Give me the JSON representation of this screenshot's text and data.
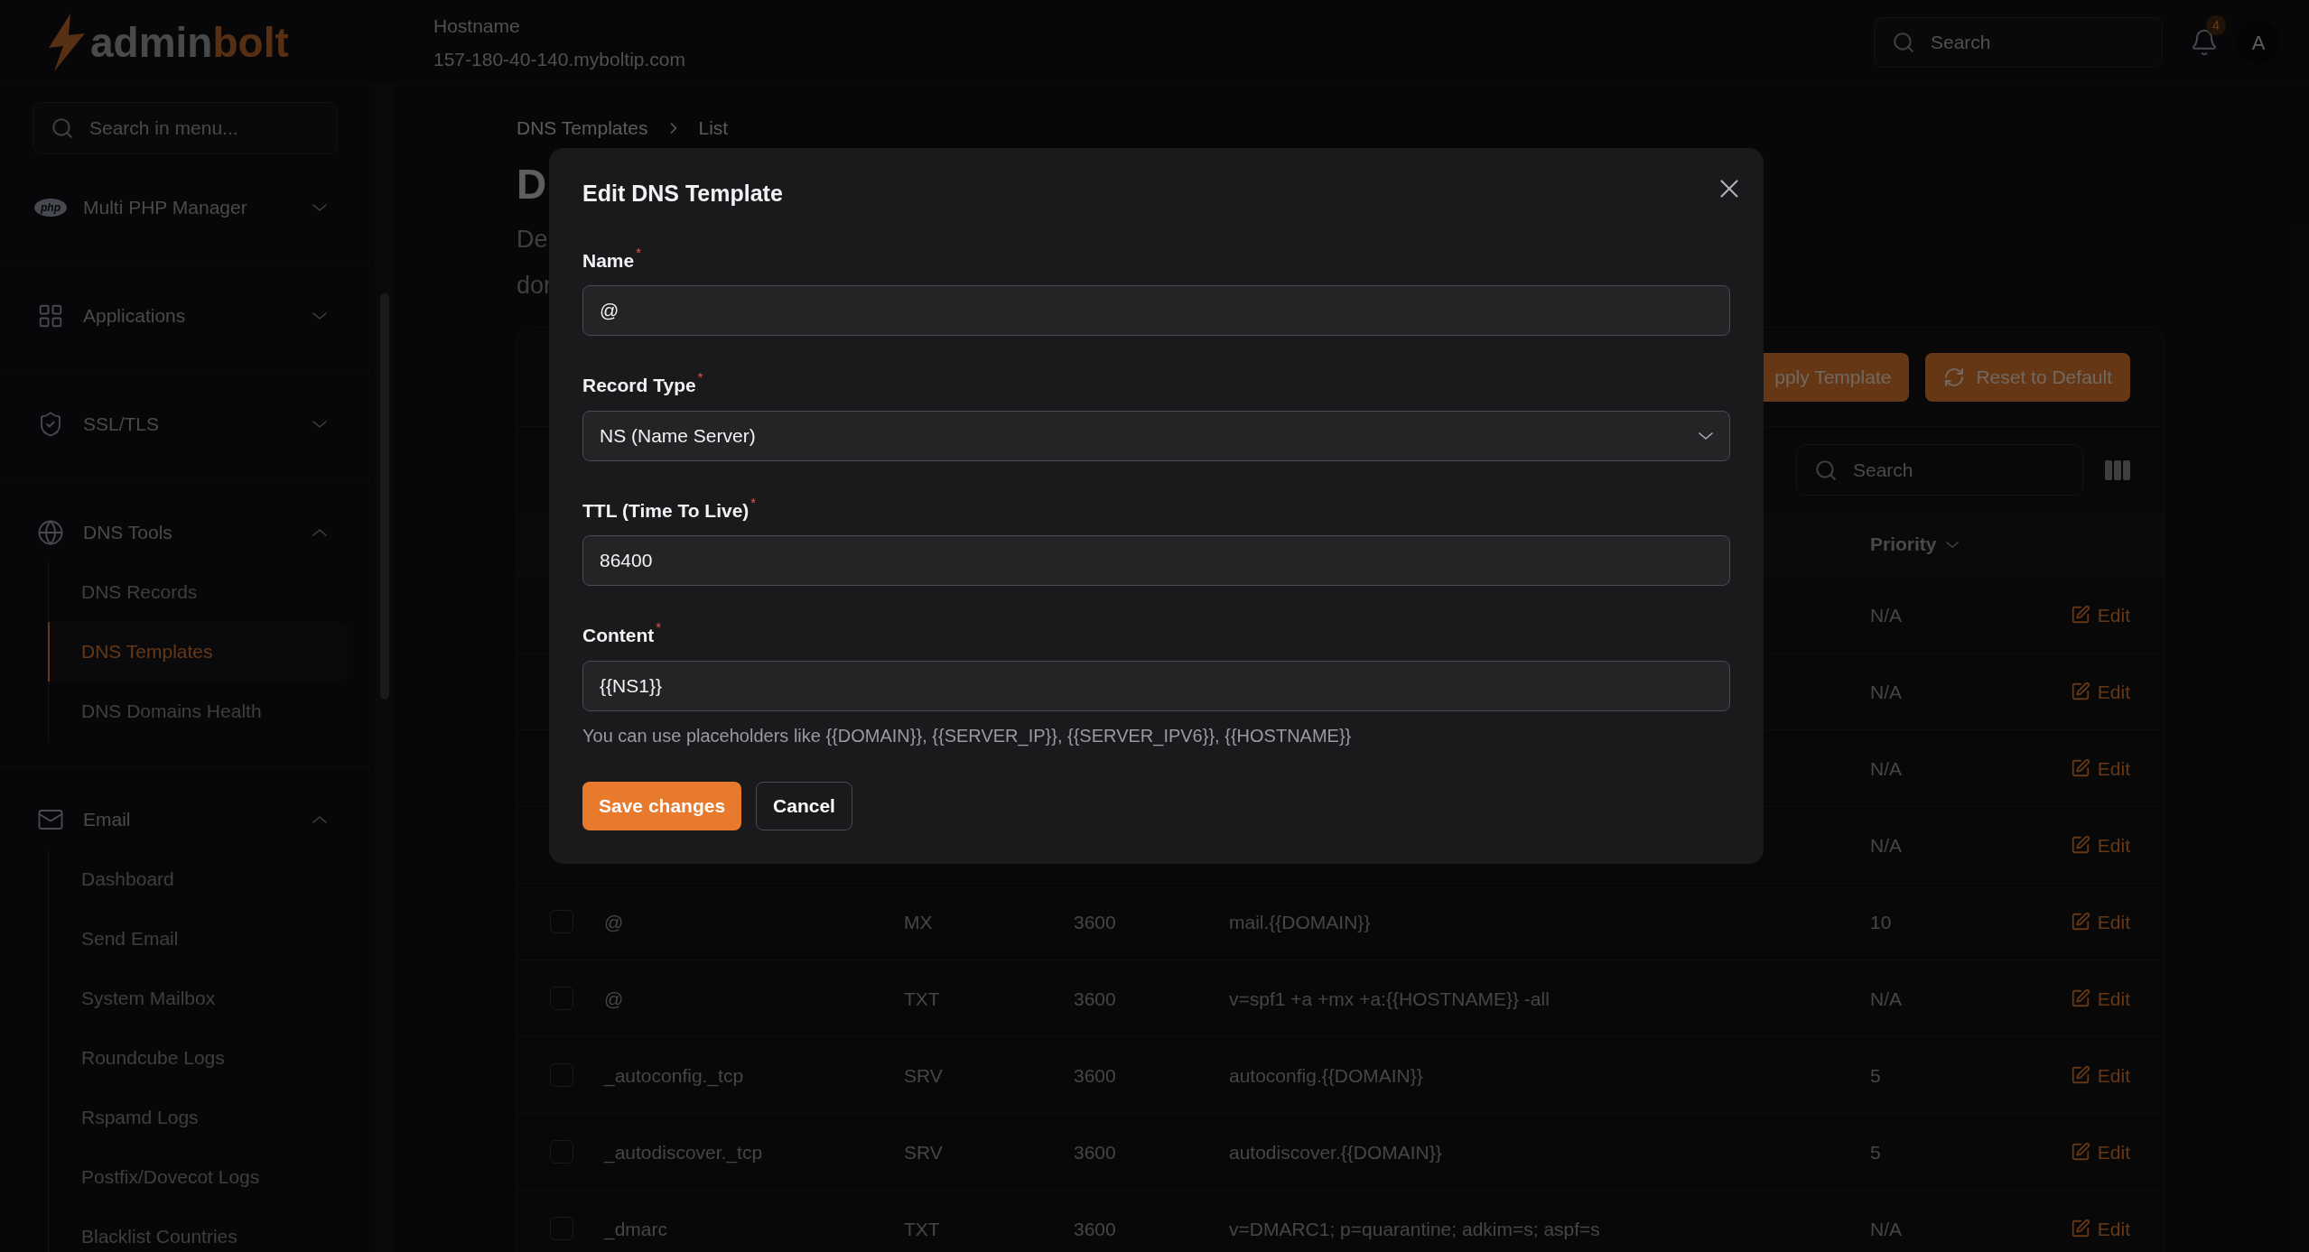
{
  "header": {
    "logo": {
      "part1": "admin",
      "part2": "bolt"
    },
    "hostname_label": "Hostname",
    "hostname": "157-180-40-140.myboltip.com",
    "search": {
      "placeholder": "Search"
    },
    "notifications": {
      "count": "4"
    },
    "avatar": "A"
  },
  "sidebar": {
    "search": {
      "placeholder": "Search in menu..."
    },
    "groups": [
      {
        "label": "Multi PHP Manager",
        "badge": "php",
        "expanded": false
      },
      {
        "label": "Applications",
        "expanded": false
      },
      {
        "label": "SSL/TLS",
        "expanded": false
      },
      {
        "label": "DNS Tools",
        "expanded": true,
        "children": [
          {
            "label": "DNS Records",
            "selected": false
          },
          {
            "label": "DNS Templates",
            "selected": true
          },
          {
            "label": "DNS Domains Health",
            "selected": false
          }
        ]
      },
      {
        "label": "Email",
        "expanded": true,
        "children": [
          {
            "label": "Dashboard",
            "selected": false
          },
          {
            "label": "Send Email",
            "selected": false
          },
          {
            "label": "System Mailbox",
            "selected": false
          },
          {
            "label": "Roundcube Logs",
            "selected": false
          },
          {
            "label": "Rspamd Logs",
            "selected": false
          },
          {
            "label": "Postfix/Dovecot Logs",
            "selected": false
          },
          {
            "label": "Blacklist Countries",
            "selected": false
          }
        ]
      }
    ]
  },
  "page": {
    "breadcrumbs": [
      "DNS Templates",
      "List"
    ],
    "title": "D",
    "description": [
      "De",
      "dor"
    ],
    "actions": [
      {
        "label": "pply Template"
      },
      {
        "label": "Reset to Default"
      }
    ],
    "table_search": {
      "placeholder": "Search"
    },
    "columns": [
      {
        "label": "Priority"
      }
    ],
    "rows": [
      {
        "priority": "N/A",
        "action": "Edit"
      },
      {
        "priority": "N/A",
        "action": "Edit"
      },
      {
        "priority": "N/A",
        "action": "Edit"
      },
      {
        "priority": "N/A",
        "action": "Edit"
      },
      {
        "checked": false,
        "name": "@",
        "type": "MX",
        "ttl": "3600",
        "content": "mail.{{DOMAIN}}",
        "priority": "10",
        "action": "Edit"
      },
      {
        "checked": false,
        "name": "@",
        "type": "TXT",
        "ttl": "3600",
        "content": "v=spf1 +a +mx +a:{{HOSTNAME}} -all",
        "priority": "N/A",
        "action": "Edit"
      },
      {
        "checked": false,
        "name": "_autoconfig._tcp",
        "type": "SRV",
        "ttl": "3600",
        "content": "autoconfig.{{DOMAIN}}",
        "priority": "5",
        "action": "Edit"
      },
      {
        "checked": false,
        "name": "_autodiscover._tcp",
        "type": "SRV",
        "ttl": "3600",
        "content": "autodiscover.{{DOMAIN}}",
        "priority": "5",
        "action": "Edit"
      },
      {
        "checked": false,
        "name": "_dmarc",
        "type": "TXT",
        "ttl": "3600",
        "content": "v=DMARC1; p=quarantine; adkim=s; aspf=s",
        "priority": "N/A",
        "action": "Edit"
      }
    ]
  },
  "dialog": {
    "title": "Edit DNS Template",
    "fields": [
      {
        "label": "Name",
        "required_mark": "*",
        "kind": "text",
        "value": "@"
      },
      {
        "label": "Record Type",
        "required_mark": "*",
        "kind": "select",
        "value": "NS (Name Server)"
      },
      {
        "label": "TTL (Time To Live)",
        "required_mark": "*",
        "kind": "text",
        "value": "86400"
      },
      {
        "label": "Content",
        "required_mark": "*",
        "kind": "text",
        "value": "{{NS1}}",
        "hint": "You can use placeholders like {{DOMAIN}}, {{SERVER_IP}}, {{SERVER_IPV6}}, {{HOSTNAME}}"
      }
    ],
    "buttons": [
      {
        "label": "Save changes",
        "kind": "primary"
      },
      {
        "label": "Cancel",
        "kind": "secondary"
      }
    ]
  }
}
